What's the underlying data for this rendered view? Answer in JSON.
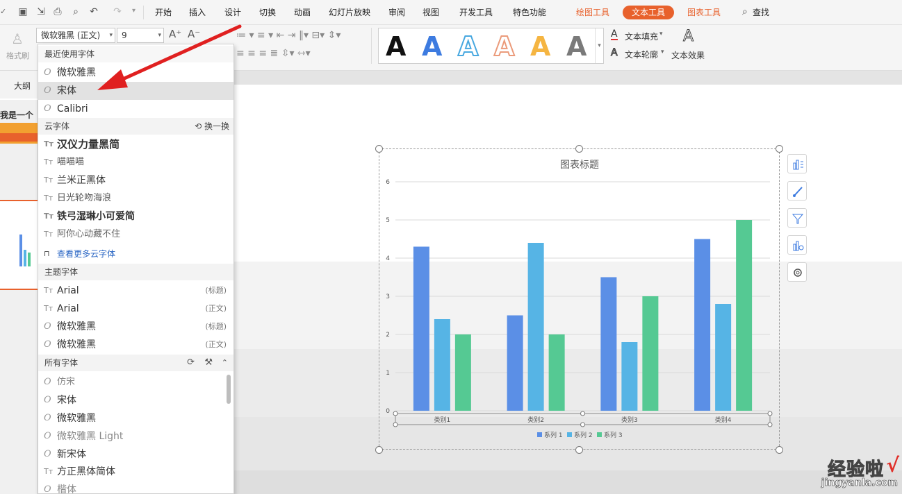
{
  "menubar": {
    "items": [
      "开始",
      "插入",
      "设计",
      "切换",
      "动画",
      "幻灯片放映",
      "审阅",
      "视图",
      "开发工具",
      "特色功能"
    ],
    "contextual_tabs": [
      "绘图工具",
      "文本工具",
      "图表工具"
    ],
    "active_tab": "文本工具",
    "search_label": "查找"
  },
  "ribbon": {
    "format_painter_label": "格式刷",
    "font_name_value": "微软雅黑 (正文)",
    "font_size_value": "9",
    "text_fill_label": "文本填充",
    "text_outline_label": "文本轮廓",
    "text_effect_label": "文本效果"
  },
  "left_panel": {
    "outline_tab": "大纲",
    "thumb_text": "我是一个"
  },
  "font_dropdown": {
    "recent_header": "最近使用字体",
    "recent": [
      "微软雅黑",
      "宋体",
      "Calibri"
    ],
    "cloud_header": "云字体",
    "cloud_refresh": "换一换",
    "cloud": [
      "汉仪力量黑简",
      "喵喵喵",
      "兰米正黑体",
      "日光轮吻海浪",
      "铁弓湿琳小可爱简",
      "阿你心动藏不住"
    ],
    "more_cloud": "查看更多云字体",
    "theme_header": "主题字体",
    "theme": [
      {
        "name": "Arial",
        "tag": "(标题)"
      },
      {
        "name": "Arial",
        "tag": "(正文)"
      },
      {
        "name": "微软雅黑",
        "tag": "(标题)"
      },
      {
        "name": "微软雅黑",
        "tag": "(正文)"
      }
    ],
    "all_header": "所有字体",
    "all": [
      "仿宋",
      "宋体",
      "微软雅黑",
      "微软雅黑 Light",
      "新宋体",
      "方正黑体简体",
      "楷体"
    ]
  },
  "chart_data": {
    "type": "bar",
    "title": "图表标题",
    "categories": [
      "类别1",
      "类别2",
      "类别3",
      "类别4"
    ],
    "series": [
      {
        "name": "系列 1",
        "values": [
          4.3,
          2.5,
          3.5,
          4.5
        ]
      },
      {
        "name": "系列 2",
        "values": [
          2.4,
          4.4,
          1.8,
          2.8
        ]
      },
      {
        "name": "系列 3",
        "values": [
          2,
          2,
          3,
          5
        ]
      }
    ],
    "colors": [
      "#5b8fe6",
      "#56b4e5",
      "#55c993"
    ],
    "ylim": [
      0,
      6
    ],
    "yticks": [
      "0",
      "1",
      "2",
      "3",
      "4",
      "5",
      "6"
    ],
    "grid": true,
    "legend": "bottom"
  },
  "watermark": {
    "text": "经验啦",
    "url": "jingyanla.com"
  }
}
